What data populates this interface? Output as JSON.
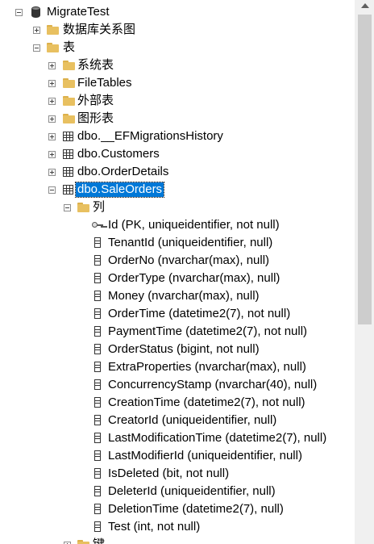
{
  "tree": {
    "root_label": "MigrateTest",
    "db_diagrams_label": "数据库关系图",
    "tables_label": "表",
    "system_tables_label": "系统表",
    "filetables_label": "FileTables",
    "external_tables_label": "外部表",
    "graph_tables_label": "图形表",
    "tables": [
      "dbo.__EFMigrationsHistory",
      "dbo.Customers",
      "dbo.OrderDetails",
      "dbo.SaleOrders"
    ],
    "columns_folder_label": "列",
    "columns": [
      "Id (PK, uniqueidentifier, not null)",
      "TenantId (uniqueidentifier, null)",
      "OrderNo (nvarchar(max), null)",
      "OrderType (nvarchar(max), null)",
      "Money (nvarchar(max), null)",
      "OrderTime (datetime2(7), not null)",
      "PaymentTime (datetime2(7), not null)",
      "OrderStatus (bigint, not null)",
      "ExtraProperties (nvarchar(max), null)",
      "ConcurrencyStamp (nvarchar(40), null)",
      "CreationTime (datetime2(7), not null)",
      "CreatorId (uniqueidentifier, null)",
      "LastModificationTime (datetime2(7), null)",
      "LastModifierId (uniqueidentifier, null)",
      "IsDeleted (bit, not null)",
      "DeleterId (uniqueidentifier, null)",
      "DeletionTime (datetime2(7), null)",
      "Test (int, not null)"
    ],
    "keys_folder_label": "键"
  },
  "colors": {
    "selection": "#0078d7",
    "folder": "#e8c060"
  }
}
